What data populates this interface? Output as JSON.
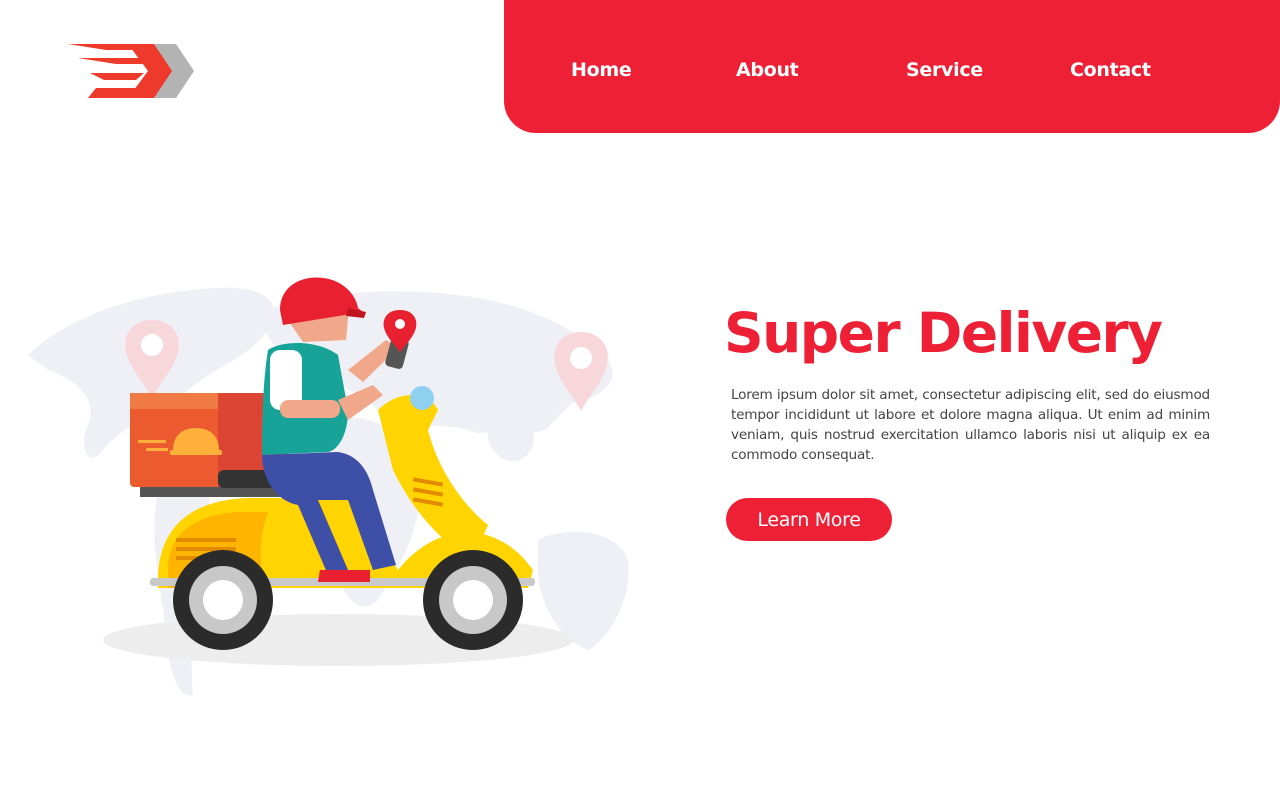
{
  "brand": {
    "logo_icon": "speed-chevron-logo",
    "primary_color": "#ee2036",
    "accent_gray": "#b3b3b3"
  },
  "nav": {
    "items": [
      {
        "label": "Home"
      },
      {
        "label": "About"
      },
      {
        "label": "Service"
      },
      {
        "label": "Contact"
      }
    ]
  },
  "hero": {
    "title": "Super Delivery",
    "description": "Lorem ipsum dolor sit amet, consectetur adipiscing elit, sed do eiusmod tempor incididunt ut labore et dolore magna aliqua. Ut enim ad minim veniam, quis nostrud exercitation ullamco laboris nisi ut aliquip ex ea commodo consequat.",
    "button_label": "Learn More",
    "illustration": "delivery-scooter-rider-world-map"
  }
}
